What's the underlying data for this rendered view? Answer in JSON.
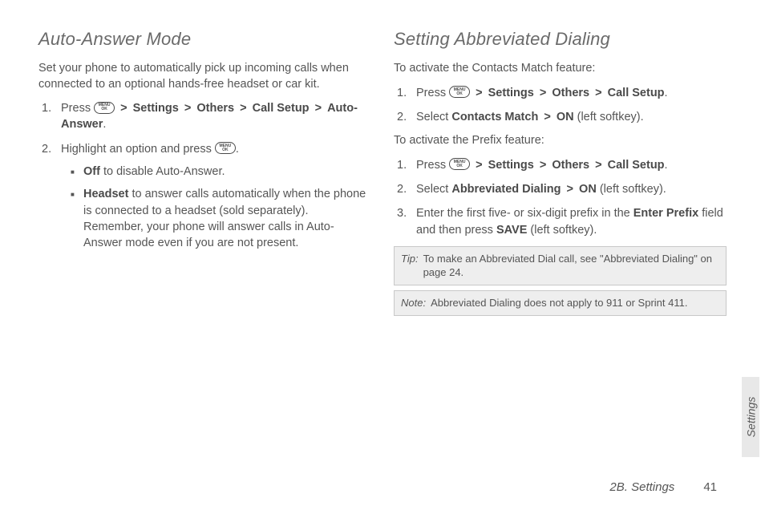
{
  "left": {
    "title": "Auto-Answer Mode",
    "intro": "Set your phone to automatically pick up incoming calls when connected to an optional hands-free headset or car kit.",
    "step1_pre": "Press ",
    "step1_path_settings": "Settings",
    "step1_path_others": "Others",
    "step1_path_callsetup": "Call Setup",
    "step1_path_auto": "Auto-Answer",
    "step1_end": ".",
    "step2_pre": "Highlight an option and press ",
    "step2_end": ".",
    "sub_off_label": "Off",
    "sub_off_text": " to disable Auto-Answer.",
    "sub_headset_label": "Headset",
    "sub_headset_text": " to answer calls automatically when the phone is connected to a headset (sold separately). Remember, your phone will answer calls in Auto-Answer mode even if you are not present."
  },
  "right": {
    "title": "Setting Abbreviated Dialing",
    "intro1": "To activate the Contacts Match feature:",
    "a_step1_pre": "Press ",
    "path_settings": "Settings",
    "path_others": "Others",
    "path_callsetup": "Call Setup",
    "a_step1_end": ".",
    "a_step2_pre": "Select ",
    "a_step2_cm": "Contacts Match",
    "a_step2_on": "ON",
    "a_step2_end": " (left softkey).",
    "intro2": "To activate the Prefix feature:",
    "b_step1_pre": "Press ",
    "b_step1_end": ".",
    "b_step2_pre": "Select ",
    "b_step2_ad": "Abbreviated Dialing",
    "b_step2_on": "ON",
    "b_step2_end": " (left softkey).",
    "b_step3_pre": "Enter the first five- or six-digit prefix in the ",
    "b_step3_field": "Enter Prefix",
    "b_step3_mid": " field and then press ",
    "b_step3_save": "SAVE",
    "b_step3_end": " (left softkey).",
    "tip_label": "Tip:",
    "tip_text": "To make an Abbreviated Dial call, see \"Abbreviated Dialing\" on page 24.",
    "note_label": "Note:",
    "note_text": "Abbreviated Dialing does not apply to 911 or Sprint 411."
  },
  "menuok_top": "MENU",
  "menuok_bottom": "OK",
  "side_tab": "Settings",
  "footer_section": "2B. Settings",
  "footer_page": "41",
  "sep": ">"
}
